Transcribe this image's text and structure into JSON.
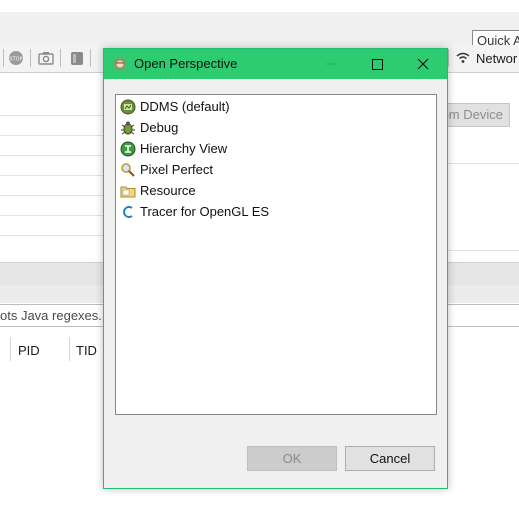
{
  "background": {
    "quick_access": "Quick A",
    "network_tab": "Networ",
    "dump_button": "om Device",
    "filter_hint": "ots Java regexes. P",
    "columns": [
      "PID",
      "TID"
    ]
  },
  "dialog": {
    "title": "Open Perspective",
    "perspectives": [
      {
        "label": "DDMS (default)",
        "icon": "ddms-icon"
      },
      {
        "label": "Debug",
        "icon": "debug-bug-icon"
      },
      {
        "label": "Hierarchy View",
        "icon": "hierarchy-view-icon"
      },
      {
        "label": "Pixel Perfect",
        "icon": "magnifier-icon"
      },
      {
        "label": "Resource",
        "icon": "folder-icon"
      },
      {
        "label": "Tracer for OpenGL ES",
        "icon": "tracer-icon"
      }
    ],
    "ok_label": "OK",
    "cancel_label": "Cancel"
  },
  "colors": {
    "title_bar": "#2ecc71",
    "dialog_border": "#1fbf70"
  }
}
